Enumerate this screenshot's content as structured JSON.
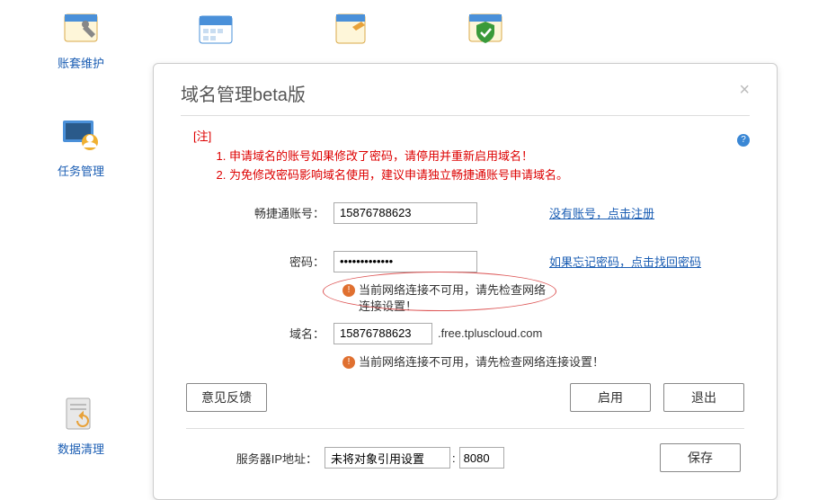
{
  "bg": {
    "maintain": "账套维护",
    "task": "任务管理",
    "data": "数据清理"
  },
  "dialog": {
    "title": "域名管理beta版",
    "noteLabel": "[注]",
    "notes": [
      "申请域名的账号如果修改了密码，请停用并重新启用域名！",
      "为免修改密码影响域名使用，建议申请独立畅捷通账号申请域名。"
    ],
    "accountLabel": "畅捷通账号：",
    "accountValue": "15876788623",
    "registerLink": "没有账号，点击注册",
    "passwordLabel": "密码：",
    "passwordValue": "•••••••••••••",
    "forgotLink": "如果忘记密码，点击找回密码",
    "warn1": "当前网络连接不可用，请先检查网络连接设置！",
    "domainLabel": "域名：",
    "domainValue": "15876788623",
    "domainSuffix": ".free.tpluscloud.com",
    "warn2": "当前网络连接不可用，请先检查网络连接设置！",
    "feedback": "意见反馈",
    "enable": "启用",
    "exit": "退出",
    "ipLabel": "服务器IP地址：",
    "ipValue": "未将对象引用设置",
    "portValue": "8080",
    "save": "保存"
  }
}
